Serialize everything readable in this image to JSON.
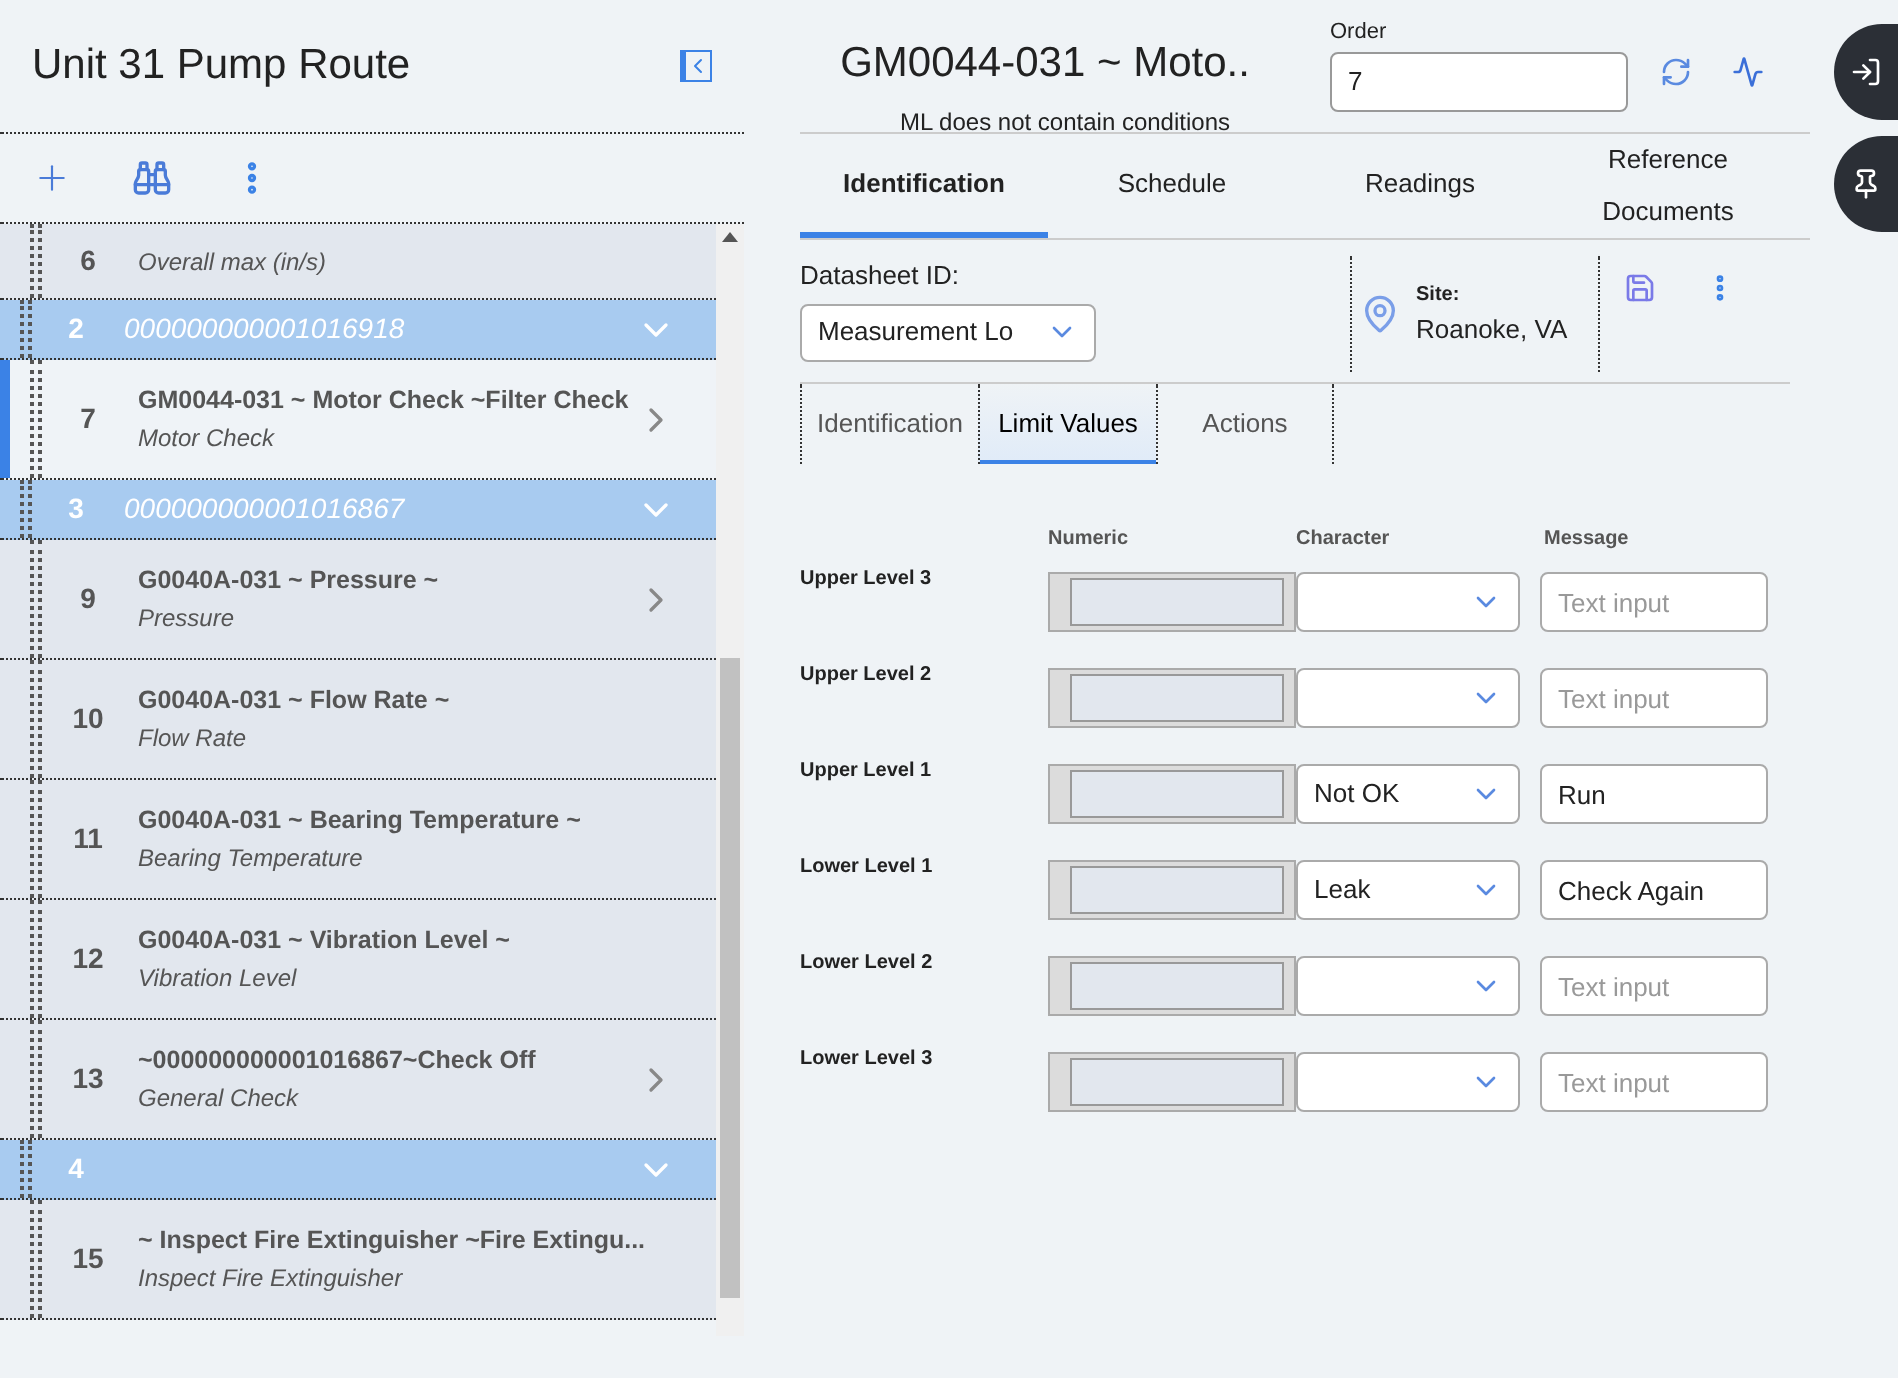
{
  "route": {
    "title": "Unit 31 Pump Route"
  },
  "list": [
    {
      "kind": "item",
      "number": "6",
      "subtitle": "Overall max (in/s)",
      "selected": false,
      "has_arrow": false
    },
    {
      "kind": "group",
      "number": "2",
      "code": "000000000001016918",
      "expanded": true
    },
    {
      "kind": "item",
      "number": "7",
      "title": "GM0044-031 ~ Motor Check ~Filter Check",
      "subtitle": "Motor Check",
      "selected": true,
      "has_arrow": true
    },
    {
      "kind": "group",
      "number": "3",
      "code": "000000000001016867",
      "expanded": true
    },
    {
      "kind": "item",
      "number": "9",
      "title": "G0040A-031 ~ Pressure ~",
      "subtitle": "Pressure",
      "selected": false,
      "has_arrow": true
    },
    {
      "kind": "item",
      "number": "10",
      "title": "G0040A-031 ~ Flow Rate ~",
      "subtitle": "Flow Rate",
      "selected": false,
      "has_arrow": false
    },
    {
      "kind": "item",
      "number": "11",
      "title": "G0040A-031 ~ Bearing Temperature ~",
      "subtitle": "Bearing Temperature",
      "selected": false,
      "has_arrow": false
    },
    {
      "kind": "item",
      "number": "12",
      "title": "G0040A-031 ~ Vibration Level ~",
      "subtitle": "Vibration Level",
      "selected": false,
      "has_arrow": false
    },
    {
      "kind": "item",
      "number": "13",
      "title": "~000000000001016867~Check Off",
      "subtitle": "General Check",
      "selected": false,
      "has_arrow": true
    },
    {
      "kind": "group",
      "number": "4",
      "expanded": true
    },
    {
      "kind": "item",
      "number": "15",
      "title": "~ Inspect Fire Extinguisher ~Fire Extingu...",
      "subtitle": "Inspect Fire Extinguisher",
      "selected": false,
      "has_arrow": false
    }
  ],
  "detail": {
    "title": "GM0044-031 ~ Moto..",
    "note": "ML does not contain conditions",
    "order_label": "Order",
    "order_value": "7"
  },
  "tabs": [
    {
      "label": "Identification",
      "selected": true
    },
    {
      "label": "Schedule",
      "selected": false
    },
    {
      "label": "Readings",
      "selected": false
    },
    {
      "label": "Reference Documents",
      "selected": false
    }
  ],
  "datasheet": {
    "label": "Datasheet ID:",
    "value": "Measurement Lo",
    "site_label": "Site:",
    "site_value": "Roanoke, VA"
  },
  "subtabs": [
    {
      "label": "Identification",
      "selected": false
    },
    {
      "label": "Limit Values",
      "selected": true
    },
    {
      "label": "Actions",
      "selected": false
    }
  ],
  "limits": {
    "columns": [
      "Numeric",
      "Character",
      "Message"
    ],
    "rows": [
      {
        "label": "Upper Level 3",
        "character": "",
        "message": "",
        "placeholder": "Text input"
      },
      {
        "label": "Upper Level 2",
        "character": "",
        "message": "",
        "placeholder": "Text input"
      },
      {
        "label": "Upper Level 1",
        "character": "Not OK",
        "message": "Run"
      },
      {
        "label": "Lower Level 1",
        "character": "Leak",
        "message": "Check Again"
      },
      {
        "label": "Lower Level 2",
        "character": "",
        "message": "",
        "placeholder": "Text input"
      },
      {
        "label": "Lower Level 3",
        "character": "",
        "message": "",
        "placeholder": "Text input"
      }
    ]
  }
}
